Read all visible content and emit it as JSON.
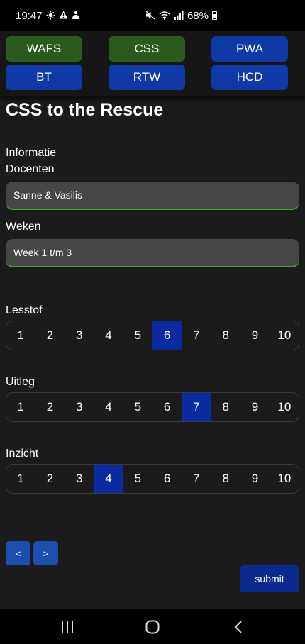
{
  "status_bar": {
    "time": "19:47",
    "left_icons": [
      "sun-icon",
      "warning-icon",
      "notification-icon"
    ],
    "right_icons": [
      "mute-icon",
      "wifi-icon",
      "signal-icon"
    ],
    "battery": "68%"
  },
  "course_nav": [
    {
      "label": "WAFS",
      "color": "#2a5a1d"
    },
    {
      "label": "CSS",
      "color": "#2a5a1d"
    },
    {
      "label": "PWA",
      "color": "#1039a8"
    },
    {
      "label": "BT",
      "color": "#1039a8"
    },
    {
      "label": "RTW",
      "color": "#1039a8"
    },
    {
      "label": "HCD",
      "color": "#1039a8"
    }
  ],
  "page": {
    "title": "CSS to the Rescue",
    "info_heading": "Informatie",
    "docenten": {
      "label": "Docenten",
      "value": "Sanne & Vasilis"
    },
    "weken": {
      "label": "Weken",
      "value": "Week 1 t/m 3"
    }
  },
  "ratings": [
    {
      "label": "Lesstof",
      "options": [
        "1",
        "2",
        "3",
        "4",
        "5",
        "6",
        "7",
        "8",
        "9",
        "10"
      ],
      "selected": "6"
    },
    {
      "label": "Uitleg",
      "options": [
        "1",
        "2",
        "3",
        "4",
        "5",
        "6",
        "7",
        "8",
        "9",
        "10"
      ],
      "selected": "7"
    },
    {
      "label": "Inzicht",
      "options": [
        "1",
        "2",
        "3",
        "4",
        "5",
        "6",
        "7",
        "8",
        "9",
        "10"
      ],
      "selected": "4"
    }
  ],
  "controls": {
    "prev_label": "<",
    "next_label": ">",
    "submit_label": "submit"
  },
  "colors": {
    "accent_green": "#3fa82e",
    "selected_blue": "#0a2aa0",
    "nav_green": "#2a5a1d",
    "nav_blue": "#1039a8"
  }
}
